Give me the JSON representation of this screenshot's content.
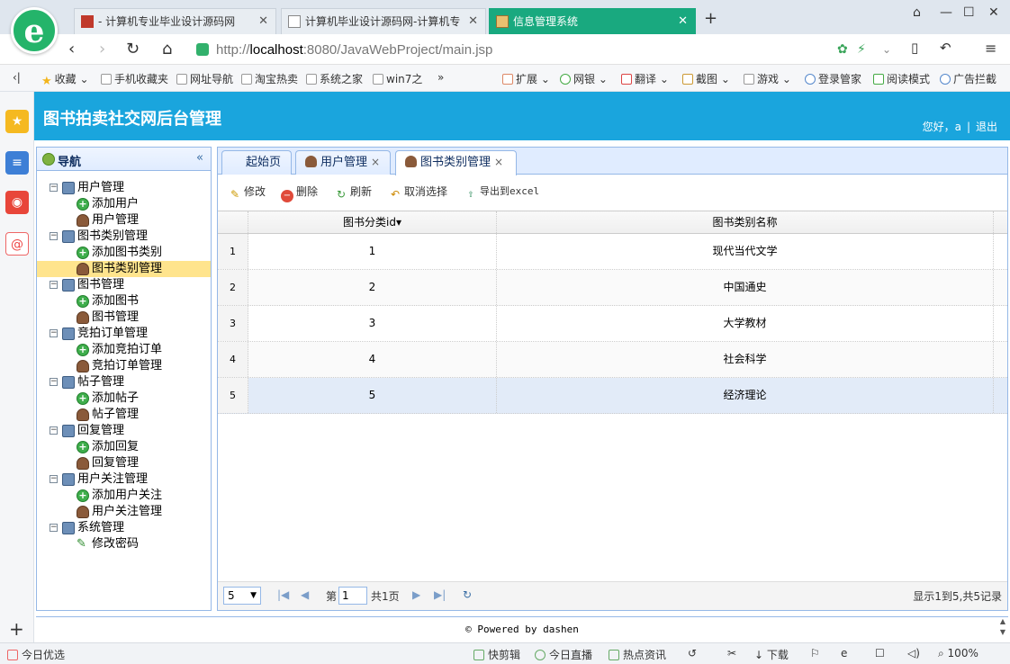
{
  "browser": {
    "tabs": [
      {
        "title": "- 计算机专业毕业设计源码网",
        "active": false
      },
      {
        "title": "计算机毕业设计源码网-计算机专",
        "active": false
      },
      {
        "title": "信息管理系统",
        "active": true
      }
    ],
    "url_prefix": "http://",
    "url_host": "localhost",
    "url_rest": ":8080/JavaWebProject/main.jsp",
    "bookmarks": [
      "收藏",
      "手机收藏夹",
      "网址导航",
      "淘宝热卖",
      "系统之家",
      "win7之"
    ],
    "bookmark_more": "»",
    "tools": [
      "扩展",
      "网银",
      "翻译",
      "截图",
      "游戏",
      "登录管家",
      "阅读模式",
      "广告拦截"
    ]
  },
  "app": {
    "title": "图书拍卖社交网后台管理",
    "greeting": "您好，",
    "username": "a",
    "logout": "退出"
  },
  "nav": {
    "title": "导航",
    "collapse": "«",
    "groups": [
      {
        "label": "用户管理",
        "children": [
          {
            "label": "添加用户",
            "icon": "add"
          },
          {
            "label": "用户管理",
            "icon": "user"
          }
        ]
      },
      {
        "label": "图书类别管理",
        "children": [
          {
            "label": "添加图书类别",
            "icon": "add"
          },
          {
            "label": "图书类别管理",
            "icon": "user",
            "selected": true
          }
        ]
      },
      {
        "label": "图书管理",
        "children": [
          {
            "label": "添加图书",
            "icon": "add"
          },
          {
            "label": "图书管理",
            "icon": "user"
          }
        ]
      },
      {
        "label": "竞拍订单管理",
        "children": [
          {
            "label": "添加竞拍订单",
            "icon": "add"
          },
          {
            "label": "竞拍订单管理",
            "icon": "user"
          }
        ]
      },
      {
        "label": "帖子管理",
        "children": [
          {
            "label": "添加帖子",
            "icon": "add"
          },
          {
            "label": "帖子管理",
            "icon": "user"
          }
        ]
      },
      {
        "label": "回复管理",
        "children": [
          {
            "label": "添加回复",
            "icon": "add"
          },
          {
            "label": "回复管理",
            "icon": "user"
          }
        ]
      },
      {
        "label": "用户关注管理",
        "children": [
          {
            "label": "添加用户关注",
            "icon": "add"
          },
          {
            "label": "用户关注管理",
            "icon": "user"
          }
        ]
      },
      {
        "label": "系统管理",
        "children": [
          {
            "label": "修改密码",
            "icon": "pencil"
          }
        ]
      }
    ]
  },
  "main": {
    "tabs": [
      {
        "label": "起始页",
        "closable": false
      },
      {
        "label": "用户管理",
        "closable": true
      },
      {
        "label": "图书类别管理",
        "closable": true,
        "active": true
      }
    ],
    "close_glyph": "×",
    "toolbar": {
      "edit": "修改",
      "delete": "删除",
      "refresh": "刷新",
      "cancel_select": "取消选择",
      "export": "导出到excel"
    },
    "columns": [
      "图书分类id",
      "图书类别名称"
    ],
    "sort_indicator": "▾",
    "rows": [
      {
        "num": "1",
        "id": "1",
        "name": "现代当代文学"
      },
      {
        "num": "2",
        "id": "2",
        "name": "中国通史"
      },
      {
        "num": "3",
        "id": "3",
        "name": "大学教材"
      },
      {
        "num": "4",
        "id": "4",
        "name": "社会科学"
      },
      {
        "num": "5",
        "id": "5",
        "name": "经济理论"
      }
    ],
    "pager": {
      "page_size": "5",
      "page_prefix": "第",
      "page_value": "1",
      "page_total": "共1页",
      "info": "显示1到5,共5记录"
    }
  },
  "footer": "© Powered by dashen",
  "status": {
    "left": "今日优选",
    "items": [
      "快剪辑",
      "今日直播",
      "热点资讯",
      "下载"
    ],
    "zoom": "100%"
  },
  "colors": {
    "header": "#1aa5dd",
    "active_browser_tab": "#19a97f",
    "selected_nav": "#ffe48d",
    "highlight_row": "#e2ebf8"
  }
}
